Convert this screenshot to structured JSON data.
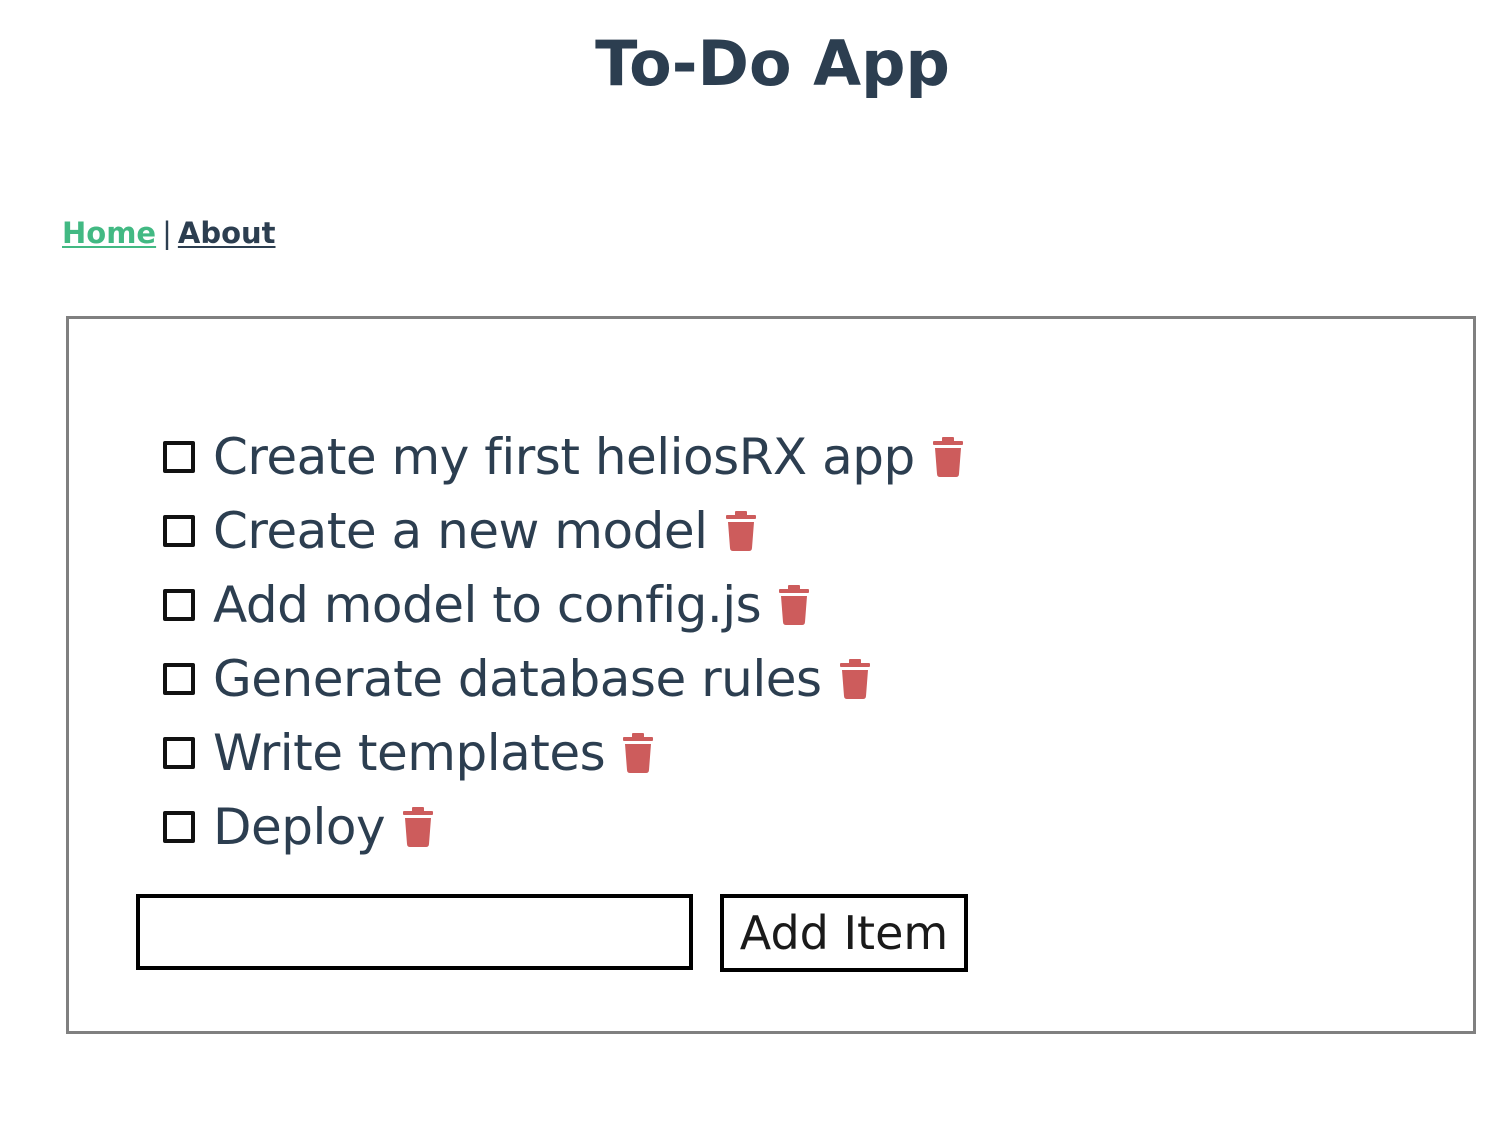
{
  "app": {
    "title": "To-Do App"
  },
  "nav": {
    "home_label": "Home",
    "separator": "|",
    "about_label": "About",
    "active": "Home"
  },
  "colors": {
    "accent": "#42b983",
    "text": "#2c3e50",
    "delete": "#cd5c5c",
    "box_border": "#808080"
  },
  "todos": [
    {
      "text": "Create my first heliosRX app",
      "done": false,
      "delete_icon": "trash-icon"
    },
    {
      "text": "Create a new model",
      "done": false,
      "delete_icon": "trash-icon"
    },
    {
      "text": "Add model to config.js",
      "done": false,
      "delete_icon": "trash-icon"
    },
    {
      "text": "Generate database rules",
      "done": false,
      "delete_icon": "trash-icon"
    },
    {
      "text": "Write templates",
      "done": false,
      "delete_icon": "trash-icon"
    },
    {
      "text": "Deploy",
      "done": false,
      "delete_icon": "trash-icon"
    }
  ],
  "new_item": {
    "value": "",
    "placeholder": ""
  },
  "add_button_label": "Add Item"
}
